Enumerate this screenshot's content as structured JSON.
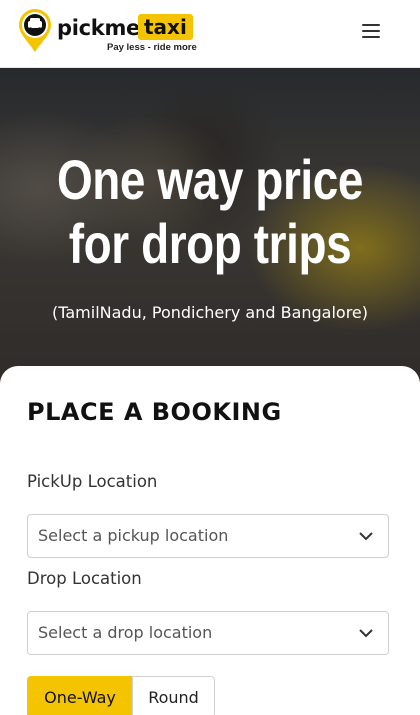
{
  "header": {
    "brand_name": "pickme",
    "brand_taxi": "taxi",
    "tagline": "Pay less - ride more",
    "logo_icon": "taxi-pin-icon",
    "menu_icon": "hamburger-icon"
  },
  "hero": {
    "title_line1": "One way price",
    "title_line2": "for drop trips",
    "subtitle": "(TamilNadu, Pondichery and Bangalore)"
  },
  "booking": {
    "title": "PLACE A BOOKING",
    "pickup_label": "PickUp Location",
    "pickup_placeholder": "Select a pickup location",
    "drop_label": "Drop Location",
    "drop_placeholder": "Select a drop location",
    "trip_types": [
      "One-Way",
      "Round"
    ],
    "selected_trip_type": "One-Way"
  },
  "colors": {
    "accent": "#f5c400",
    "text": "#222222"
  }
}
